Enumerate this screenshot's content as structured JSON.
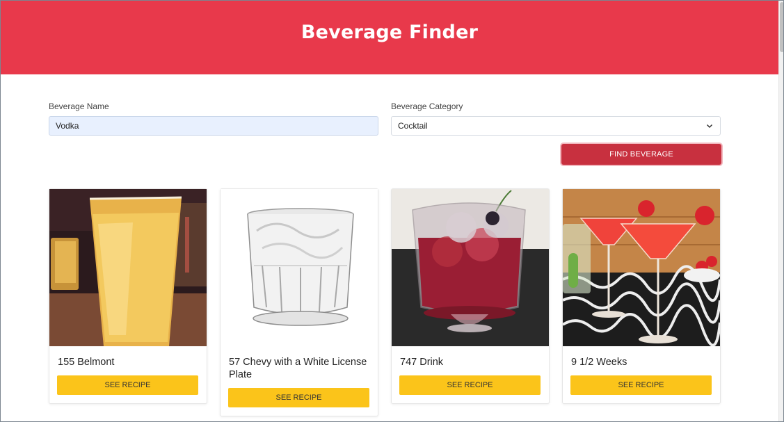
{
  "header": {
    "title": "Beverage Finder"
  },
  "form": {
    "name_label": "Beverage Name",
    "name_value": "Vodka",
    "category_label": "Beverage Category",
    "category_value": "Cocktail",
    "find_label": "FIND BEVERAGE"
  },
  "cards": [
    {
      "title": "155 Belmont",
      "button": "SEE RECIPE"
    },
    {
      "title": "57 Chevy with a White License Plate",
      "button": "SEE RECIPE"
    },
    {
      "title": "747 Drink",
      "button": "SEE RECIPE"
    },
    {
      "title": "9 1/2 Weeks",
      "button": "SEE RECIPE"
    }
  ],
  "colors": {
    "header_bg": "#e8394b",
    "find_button": "#c8303f",
    "recipe_button": "#fbc41a"
  }
}
